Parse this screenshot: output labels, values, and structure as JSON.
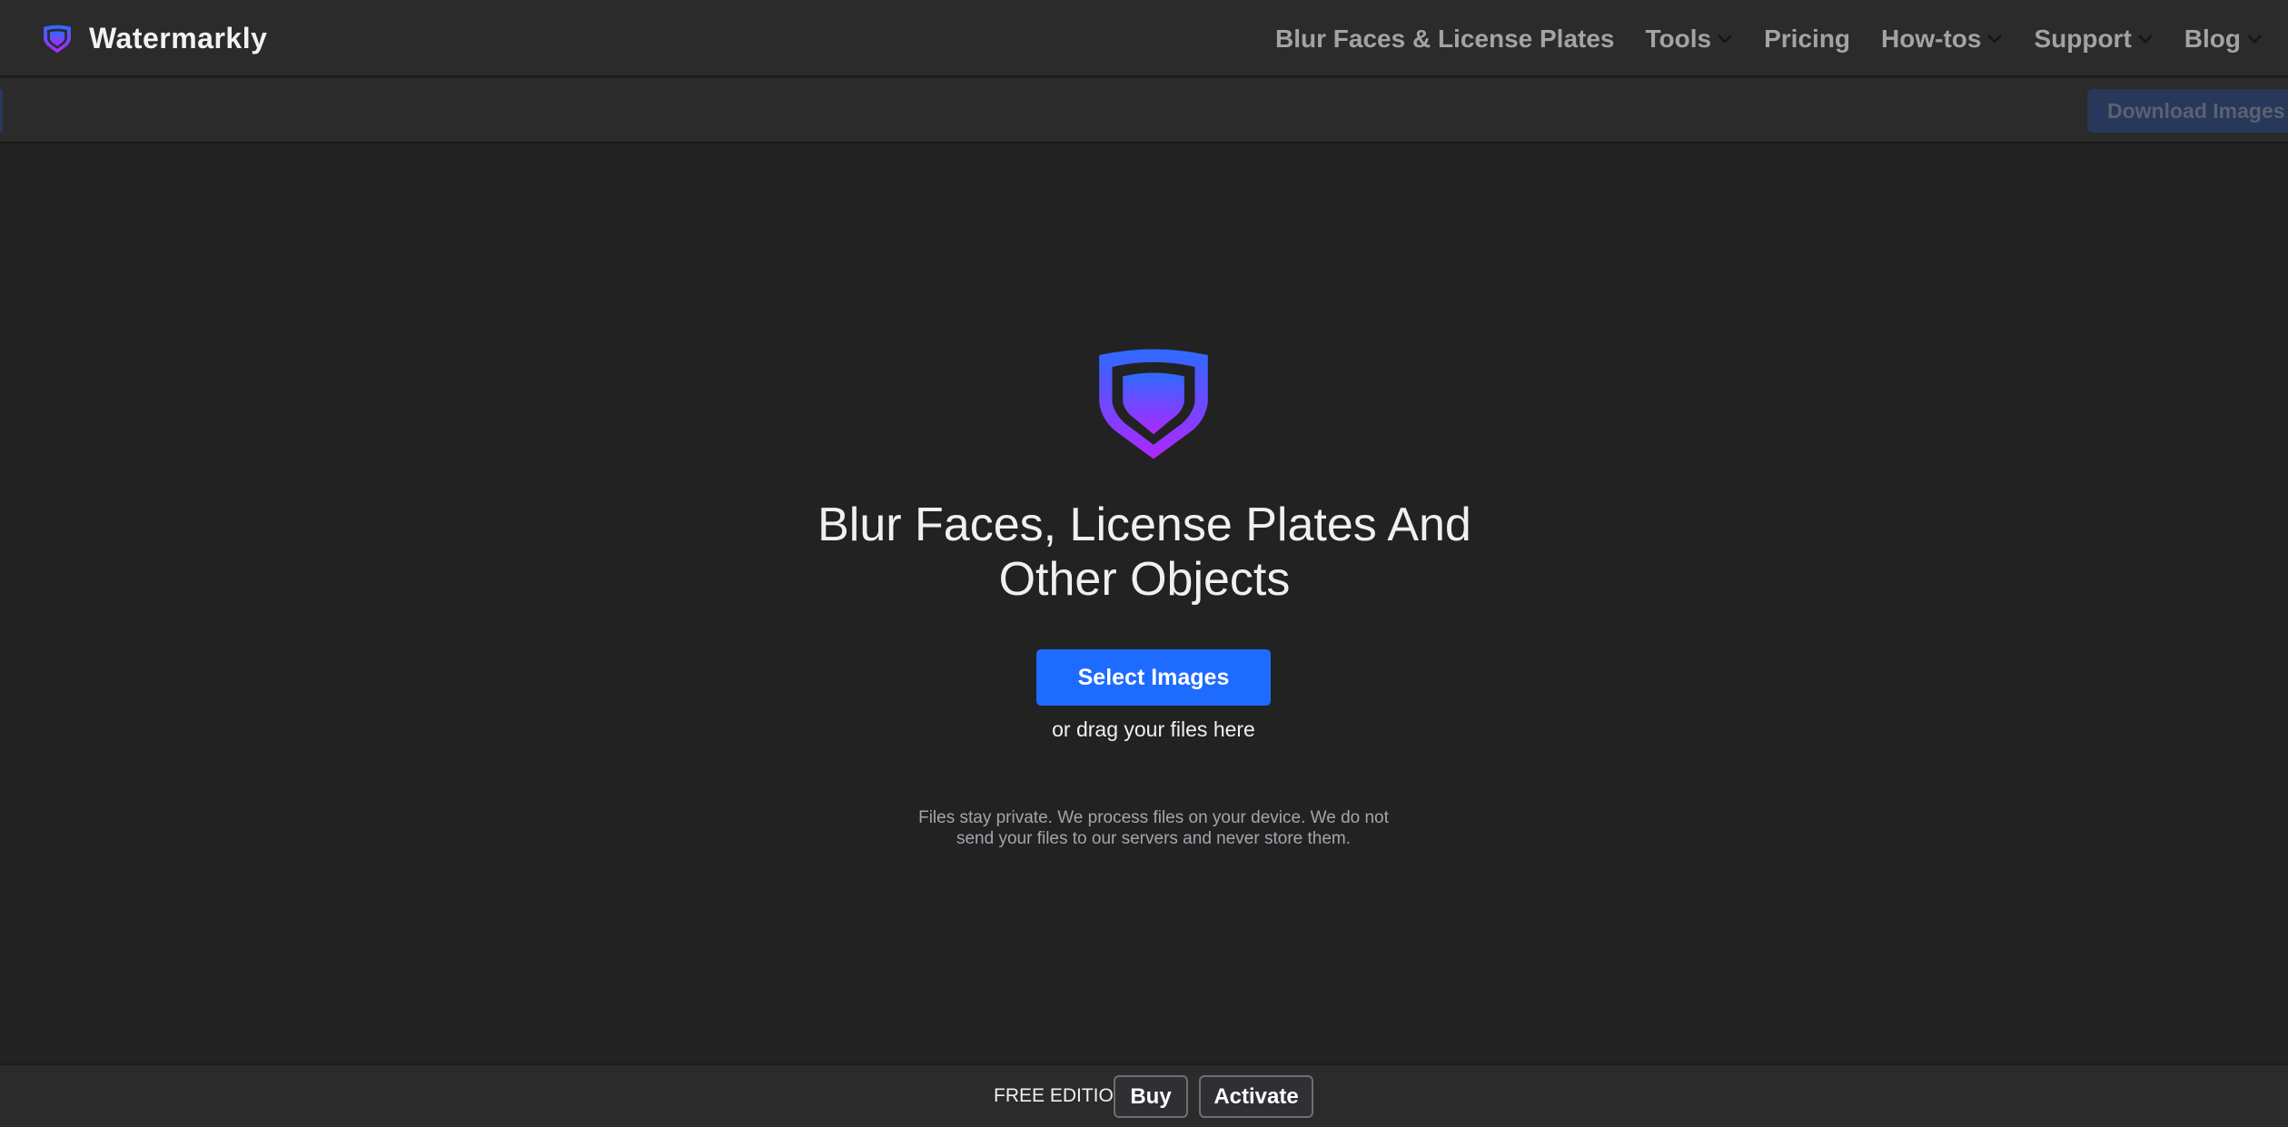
{
  "header": {
    "brand_name": "Watermarkly",
    "logo_icon": "shield-logo-icon",
    "nav": [
      {
        "label": "Blur Faces & License Plates",
        "dropdown": false
      },
      {
        "label": "Tools",
        "dropdown": true
      },
      {
        "label": "Pricing",
        "dropdown": false
      },
      {
        "label": "How-tos",
        "dropdown": true
      },
      {
        "label": "Support",
        "dropdown": true
      },
      {
        "label": "Blog",
        "dropdown": true
      }
    ]
  },
  "toolbar": {
    "download_label": "Download Images"
  },
  "hero": {
    "title_line1": "Blur Faces, License Plates And",
    "title_line2": "Other Objects",
    "select_label": "Select Images",
    "drag_hint": "or drag your files here",
    "privacy_line1": "Files stay private. We process files on your device. We do not",
    "privacy_line2": "send your files to our servers and never store them."
  },
  "footer": {
    "edition": "FREE EDITION",
    "buy_label": "Buy",
    "activate_label": "Activate"
  },
  "colors": {
    "accent": "#1e6bff",
    "logo_gradient_top": "#2d6bff",
    "logo_gradient_bottom": "#b026ff",
    "background": "#222222",
    "bar_background": "#2b2b2b"
  }
}
